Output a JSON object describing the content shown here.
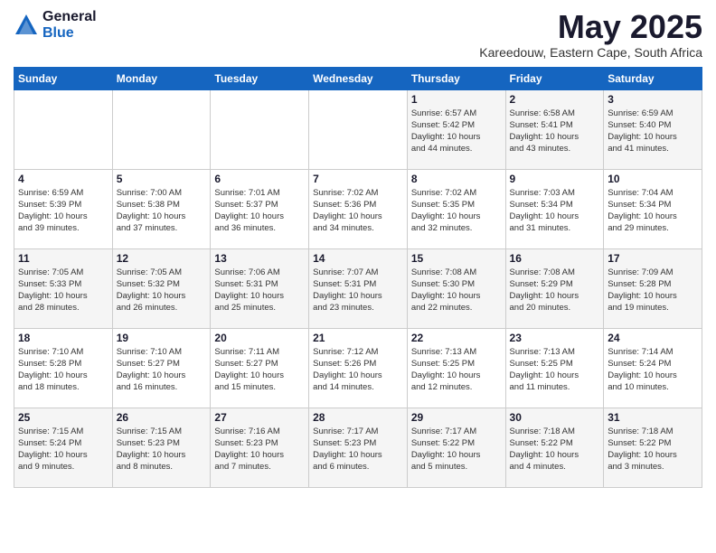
{
  "logo": {
    "general": "General",
    "blue": "Blue"
  },
  "title": "May 2025",
  "location": "Kareedouw, Eastern Cape, South Africa",
  "days_header": [
    "Sunday",
    "Monday",
    "Tuesday",
    "Wednesday",
    "Thursday",
    "Friday",
    "Saturday"
  ],
  "weeks": [
    [
      {
        "day": "",
        "info": ""
      },
      {
        "day": "",
        "info": ""
      },
      {
        "day": "",
        "info": ""
      },
      {
        "day": "",
        "info": ""
      },
      {
        "day": "1",
        "info": "Sunrise: 6:57 AM\nSunset: 5:42 PM\nDaylight: 10 hours\nand 44 minutes."
      },
      {
        "day": "2",
        "info": "Sunrise: 6:58 AM\nSunset: 5:41 PM\nDaylight: 10 hours\nand 43 minutes."
      },
      {
        "day": "3",
        "info": "Sunrise: 6:59 AM\nSunset: 5:40 PM\nDaylight: 10 hours\nand 41 minutes."
      }
    ],
    [
      {
        "day": "4",
        "info": "Sunrise: 6:59 AM\nSunset: 5:39 PM\nDaylight: 10 hours\nand 39 minutes."
      },
      {
        "day": "5",
        "info": "Sunrise: 7:00 AM\nSunset: 5:38 PM\nDaylight: 10 hours\nand 37 minutes."
      },
      {
        "day": "6",
        "info": "Sunrise: 7:01 AM\nSunset: 5:37 PM\nDaylight: 10 hours\nand 36 minutes."
      },
      {
        "day": "7",
        "info": "Sunrise: 7:02 AM\nSunset: 5:36 PM\nDaylight: 10 hours\nand 34 minutes."
      },
      {
        "day": "8",
        "info": "Sunrise: 7:02 AM\nSunset: 5:35 PM\nDaylight: 10 hours\nand 32 minutes."
      },
      {
        "day": "9",
        "info": "Sunrise: 7:03 AM\nSunset: 5:34 PM\nDaylight: 10 hours\nand 31 minutes."
      },
      {
        "day": "10",
        "info": "Sunrise: 7:04 AM\nSunset: 5:34 PM\nDaylight: 10 hours\nand 29 minutes."
      }
    ],
    [
      {
        "day": "11",
        "info": "Sunrise: 7:05 AM\nSunset: 5:33 PM\nDaylight: 10 hours\nand 28 minutes."
      },
      {
        "day": "12",
        "info": "Sunrise: 7:05 AM\nSunset: 5:32 PM\nDaylight: 10 hours\nand 26 minutes."
      },
      {
        "day": "13",
        "info": "Sunrise: 7:06 AM\nSunset: 5:31 PM\nDaylight: 10 hours\nand 25 minutes."
      },
      {
        "day": "14",
        "info": "Sunrise: 7:07 AM\nSunset: 5:31 PM\nDaylight: 10 hours\nand 23 minutes."
      },
      {
        "day": "15",
        "info": "Sunrise: 7:08 AM\nSunset: 5:30 PM\nDaylight: 10 hours\nand 22 minutes."
      },
      {
        "day": "16",
        "info": "Sunrise: 7:08 AM\nSunset: 5:29 PM\nDaylight: 10 hours\nand 20 minutes."
      },
      {
        "day": "17",
        "info": "Sunrise: 7:09 AM\nSunset: 5:28 PM\nDaylight: 10 hours\nand 19 minutes."
      }
    ],
    [
      {
        "day": "18",
        "info": "Sunrise: 7:10 AM\nSunset: 5:28 PM\nDaylight: 10 hours\nand 18 minutes."
      },
      {
        "day": "19",
        "info": "Sunrise: 7:10 AM\nSunset: 5:27 PM\nDaylight: 10 hours\nand 16 minutes."
      },
      {
        "day": "20",
        "info": "Sunrise: 7:11 AM\nSunset: 5:27 PM\nDaylight: 10 hours\nand 15 minutes."
      },
      {
        "day": "21",
        "info": "Sunrise: 7:12 AM\nSunset: 5:26 PM\nDaylight: 10 hours\nand 14 minutes."
      },
      {
        "day": "22",
        "info": "Sunrise: 7:13 AM\nSunset: 5:25 PM\nDaylight: 10 hours\nand 12 minutes."
      },
      {
        "day": "23",
        "info": "Sunrise: 7:13 AM\nSunset: 5:25 PM\nDaylight: 10 hours\nand 11 minutes."
      },
      {
        "day": "24",
        "info": "Sunrise: 7:14 AM\nSunset: 5:24 PM\nDaylight: 10 hours\nand 10 minutes."
      }
    ],
    [
      {
        "day": "25",
        "info": "Sunrise: 7:15 AM\nSunset: 5:24 PM\nDaylight: 10 hours\nand 9 minutes."
      },
      {
        "day": "26",
        "info": "Sunrise: 7:15 AM\nSunset: 5:23 PM\nDaylight: 10 hours\nand 8 minutes."
      },
      {
        "day": "27",
        "info": "Sunrise: 7:16 AM\nSunset: 5:23 PM\nDaylight: 10 hours\nand 7 minutes."
      },
      {
        "day": "28",
        "info": "Sunrise: 7:17 AM\nSunset: 5:23 PM\nDaylight: 10 hours\nand 6 minutes."
      },
      {
        "day": "29",
        "info": "Sunrise: 7:17 AM\nSunset: 5:22 PM\nDaylight: 10 hours\nand 5 minutes."
      },
      {
        "day": "30",
        "info": "Sunrise: 7:18 AM\nSunset: 5:22 PM\nDaylight: 10 hours\nand 4 minutes."
      },
      {
        "day": "31",
        "info": "Sunrise: 7:18 AM\nSunset: 5:22 PM\nDaylight: 10 hours\nand 3 minutes."
      }
    ]
  ]
}
